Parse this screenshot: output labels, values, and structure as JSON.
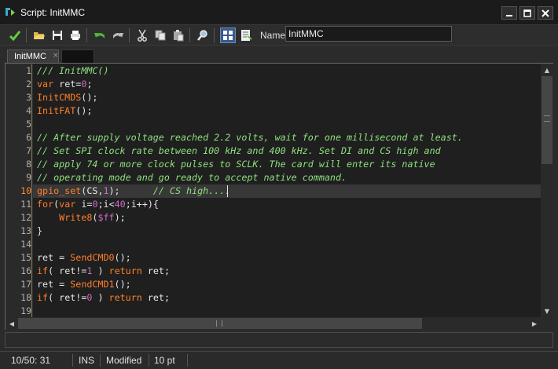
{
  "window": {
    "title": "Script: InitMMC"
  },
  "window_controls": {
    "minimize": "▁",
    "maximize": "☐",
    "close": "✕"
  },
  "toolbar": {
    "name_label": "Name:",
    "name_value": "InitMMC"
  },
  "tabs": [
    {
      "label": "InitMMC",
      "close": "×"
    }
  ],
  "editor": {
    "current_line": 10,
    "lines": [
      "/// InitMMC()",
      "var ret=0;",
      "InitCMDS();",
      "InitFAT();",
      "",
      "// After supply voltage reached 2.2 volts, wait for one millisecond at least.",
      "// Set SPI clock rate between 100 kHz and 400 kHz. Set DI and CS high and",
      "// apply 74 or more clock pulses to SCLK. The card will enter its native",
      "// operating mode and go ready to accept native command.",
      "gpio_set(CS,1);      // CS high....",
      "for(var i=0;i<40;i++){",
      "    Write8($ff);",
      "}",
      "",
      "ret = SendCMD0();",
      "if( ret!=1 ) return ret;",
      "ret = SendCMD1();",
      "if( ret!=0 ) return ret;",
      ""
    ]
  },
  "statusbar": {
    "position": "10/50:  31",
    "mode": "INS",
    "state": "Modified",
    "font_size": "10 pt"
  },
  "colors": {
    "keyword": "#ff7f2a",
    "comment": "#8fe07f",
    "number": "#d06cc8",
    "current_line_number": "#ff8c3a"
  }
}
